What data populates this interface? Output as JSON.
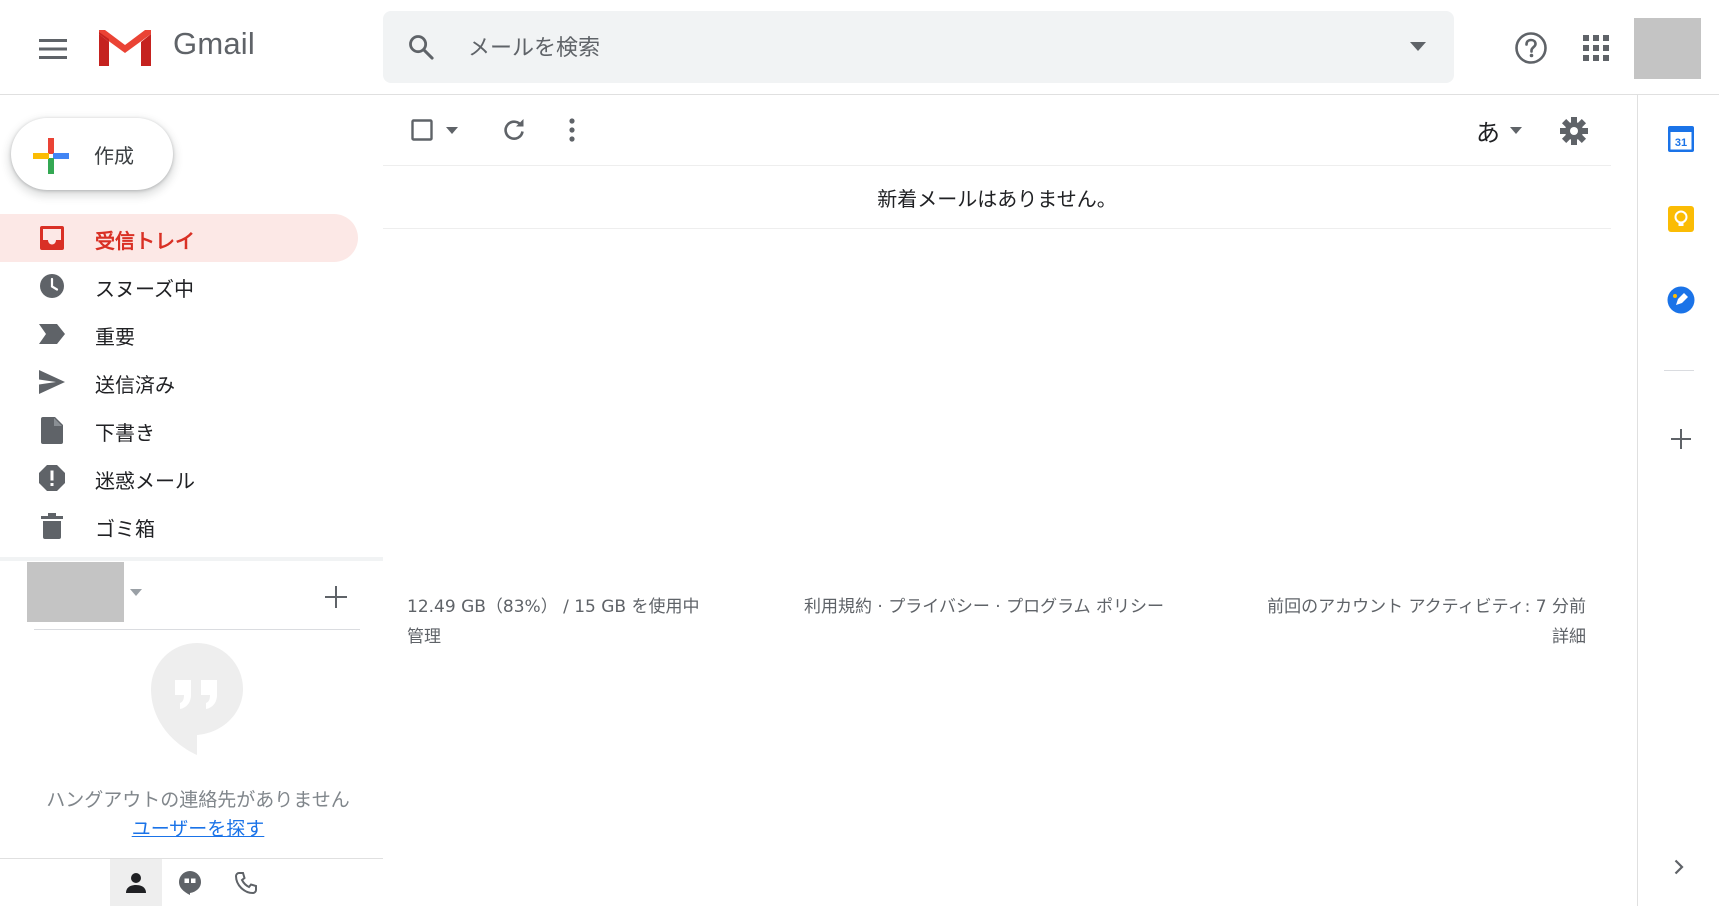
{
  "header": {
    "app_name": "Gmail",
    "search_placeholder": "メールを検索"
  },
  "sidebar": {
    "compose_label": "作成",
    "items": [
      {
        "label": "受信トレイ",
        "icon": "inbox-icon",
        "active": true
      },
      {
        "label": "スヌーズ中",
        "icon": "clock-icon",
        "active": false
      },
      {
        "label": "重要",
        "icon": "important-icon",
        "active": false
      },
      {
        "label": "送信済み",
        "icon": "send-icon",
        "active": false
      },
      {
        "label": "下書き",
        "icon": "draft-icon",
        "active": false
      },
      {
        "label": "迷惑メール",
        "icon": "spam-icon",
        "active": false
      },
      {
        "label": "ゴミ箱",
        "icon": "trash-icon",
        "active": false
      }
    ]
  },
  "hangouts": {
    "empty_text": "ハングアウトの連絡先がありません",
    "find_people_link": "ユーザーを探す"
  },
  "toolbar": {
    "input_tools_label": "あ"
  },
  "main": {
    "empty_message": "新着メールはありません。"
  },
  "footer": {
    "storage_text": "12.49 GB（83%） / 15 GB を使用中",
    "manage_link": "管理",
    "policies_text": "利用規約 · プライバシー · プログラム ポリシー",
    "last_activity_text": "前回のアカウント アクティビティ: 7 分前",
    "details_link": "詳細"
  },
  "side_panel": {
    "calendar_day": "31"
  },
  "colors": {
    "accent_red": "#d93025",
    "active_bg": "#fce8e6",
    "link_blue": "#1a73e8",
    "icon_gray": "#5f6368"
  }
}
